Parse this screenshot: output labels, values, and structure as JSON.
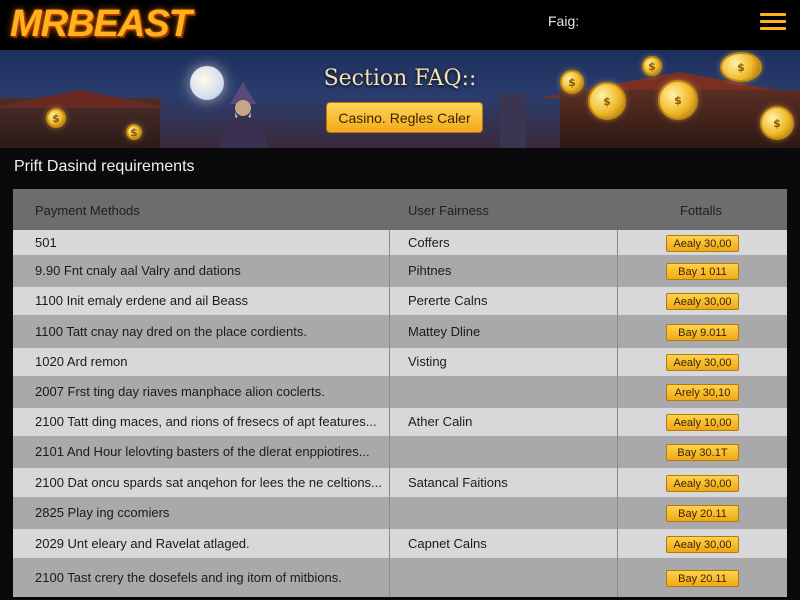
{
  "header": {
    "logo_text": "MRBEAST",
    "faq_link": "Faig:",
    "menu_icon": "hamburger-menu-icon",
    "accent": "#ffb21e"
  },
  "banner": {
    "title": "Section FAQ::",
    "button_label": "Casino. Regles Caler"
  },
  "section": {
    "title": "Prift Dasind requirements"
  },
  "table": {
    "columns": [
      "Payment Methods",
      "User Fairness",
      "Fottalls"
    ],
    "rows": [
      {
        "method": "501",
        "fairness": "Coffers",
        "badge": "Aealy 30,00"
      },
      {
        "method": "9.90 Fnt cnaly aal Valry and dations",
        "fairness": "Pihtnes",
        "badge": "Bay 1 011"
      },
      {
        "method": "1100 Init emaly erdene and ail Beass",
        "fairness": "Pererte Calns",
        "badge": "Aealy 30,00"
      },
      {
        "method": "1100 Tatt cnay nay dred on the place cordients.",
        "fairness": "Mattey Dline",
        "badge": "Bay 9.011"
      },
      {
        "method": "1020 Ard remon",
        "fairness": "Visting",
        "badge": "Aealy 30,00"
      },
      {
        "method": "2007 Frst ting day riaves manphace alion coclerts.",
        "fairness": "",
        "badge": "Arely 30,10"
      },
      {
        "method": "2100 Tatt ding maces, and rions of fresecs of apt features...",
        "fairness": "Ather Calin",
        "badge": "Aealy 10,00"
      },
      {
        "method": "2101 And Hour lelovting basters of the dlerat enppiotires...",
        "fairness": "",
        "badge": "Bay 30.1T"
      },
      {
        "method": "2100 Dat oncu spards sat anqehon for lees the ne celtions...",
        "fairness": "Satancal Faitions",
        "badge": "Aealy 30,00"
      },
      {
        "method": "2825 Play ing ccomiers",
        "fairness": "",
        "badge": "Bay 20.11"
      },
      {
        "method": "2029 Unt eleary and Ravelat atlaged.",
        "fairness": "Capnet Calns",
        "badge": "Aealy 30,00"
      },
      {
        "method": "2100 Tast crery the dosefels and ing itom of mitbions.",
        "fairness": "",
        "badge": "Bay 20.11"
      }
    ]
  }
}
